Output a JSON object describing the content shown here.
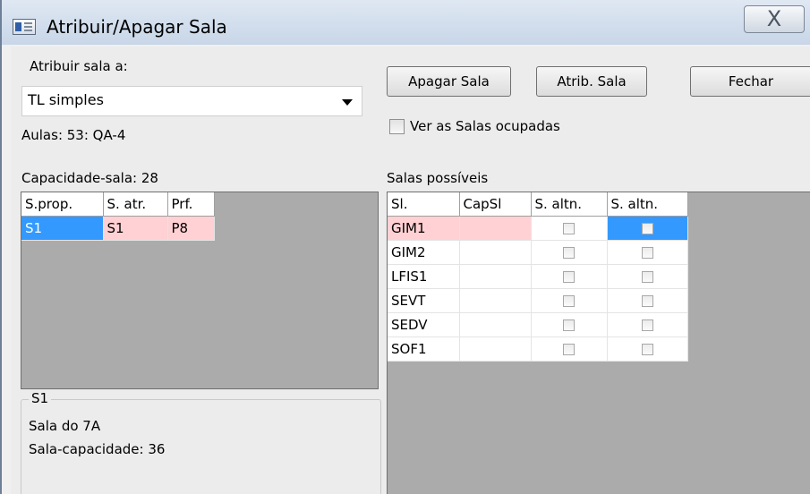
{
  "window": {
    "title": "Atribuir/Apagar Sala",
    "close_glyph": "X"
  },
  "assign": {
    "label": "Atribuir sala a:",
    "selected": "TL simples",
    "aulas": "Aulas: 53: QA-4",
    "capacity": "Capacidade-sala: 28"
  },
  "buttons": {
    "apagar": "Apagar Sala",
    "atrib": "Atrib. Sala",
    "fechar": "Fechar"
  },
  "ver_ocupadas": {
    "label": "Ver as Salas ocupadas",
    "checked": false
  },
  "left_grid": {
    "columns": [
      "S.prop.",
      "S. atr.",
      "Prf."
    ],
    "rows": [
      {
        "sprop": "S1",
        "satr": "S1",
        "prf": "P8"
      }
    ]
  },
  "salas_possiveis": {
    "label": "Salas possíveis",
    "columns": [
      "Sl.",
      "CapSl",
      "S. altn.",
      "S. altn."
    ],
    "rows": [
      {
        "sl": "GIM1",
        "cap": "",
        "altn1": false,
        "altn2": false
      },
      {
        "sl": "GIM2",
        "cap": "",
        "altn1": false,
        "altn2": false
      },
      {
        "sl": "LFIS1",
        "cap": "",
        "altn1": false,
        "altn2": false
      },
      {
        "sl": "SEVT",
        "cap": "",
        "altn1": false,
        "altn2": false
      },
      {
        "sl": "SEDV",
        "cap": "",
        "altn1": false,
        "altn2": false
      },
      {
        "sl": "SOF1",
        "cap": "",
        "altn1": false,
        "altn2": false
      }
    ]
  },
  "detail": {
    "legend": "S1",
    "line1": "Sala do 7A",
    "line2": "Sala-capacidade: 36"
  },
  "colors": {
    "selected_blue": "#3399ff",
    "pink": "#ffd1d4",
    "client_bg": "#ececec",
    "grid_bg": "#ababab"
  },
  "icons": {
    "app": "window-app-icon",
    "close": "close-icon",
    "dropdown": "chevron-down-icon"
  }
}
